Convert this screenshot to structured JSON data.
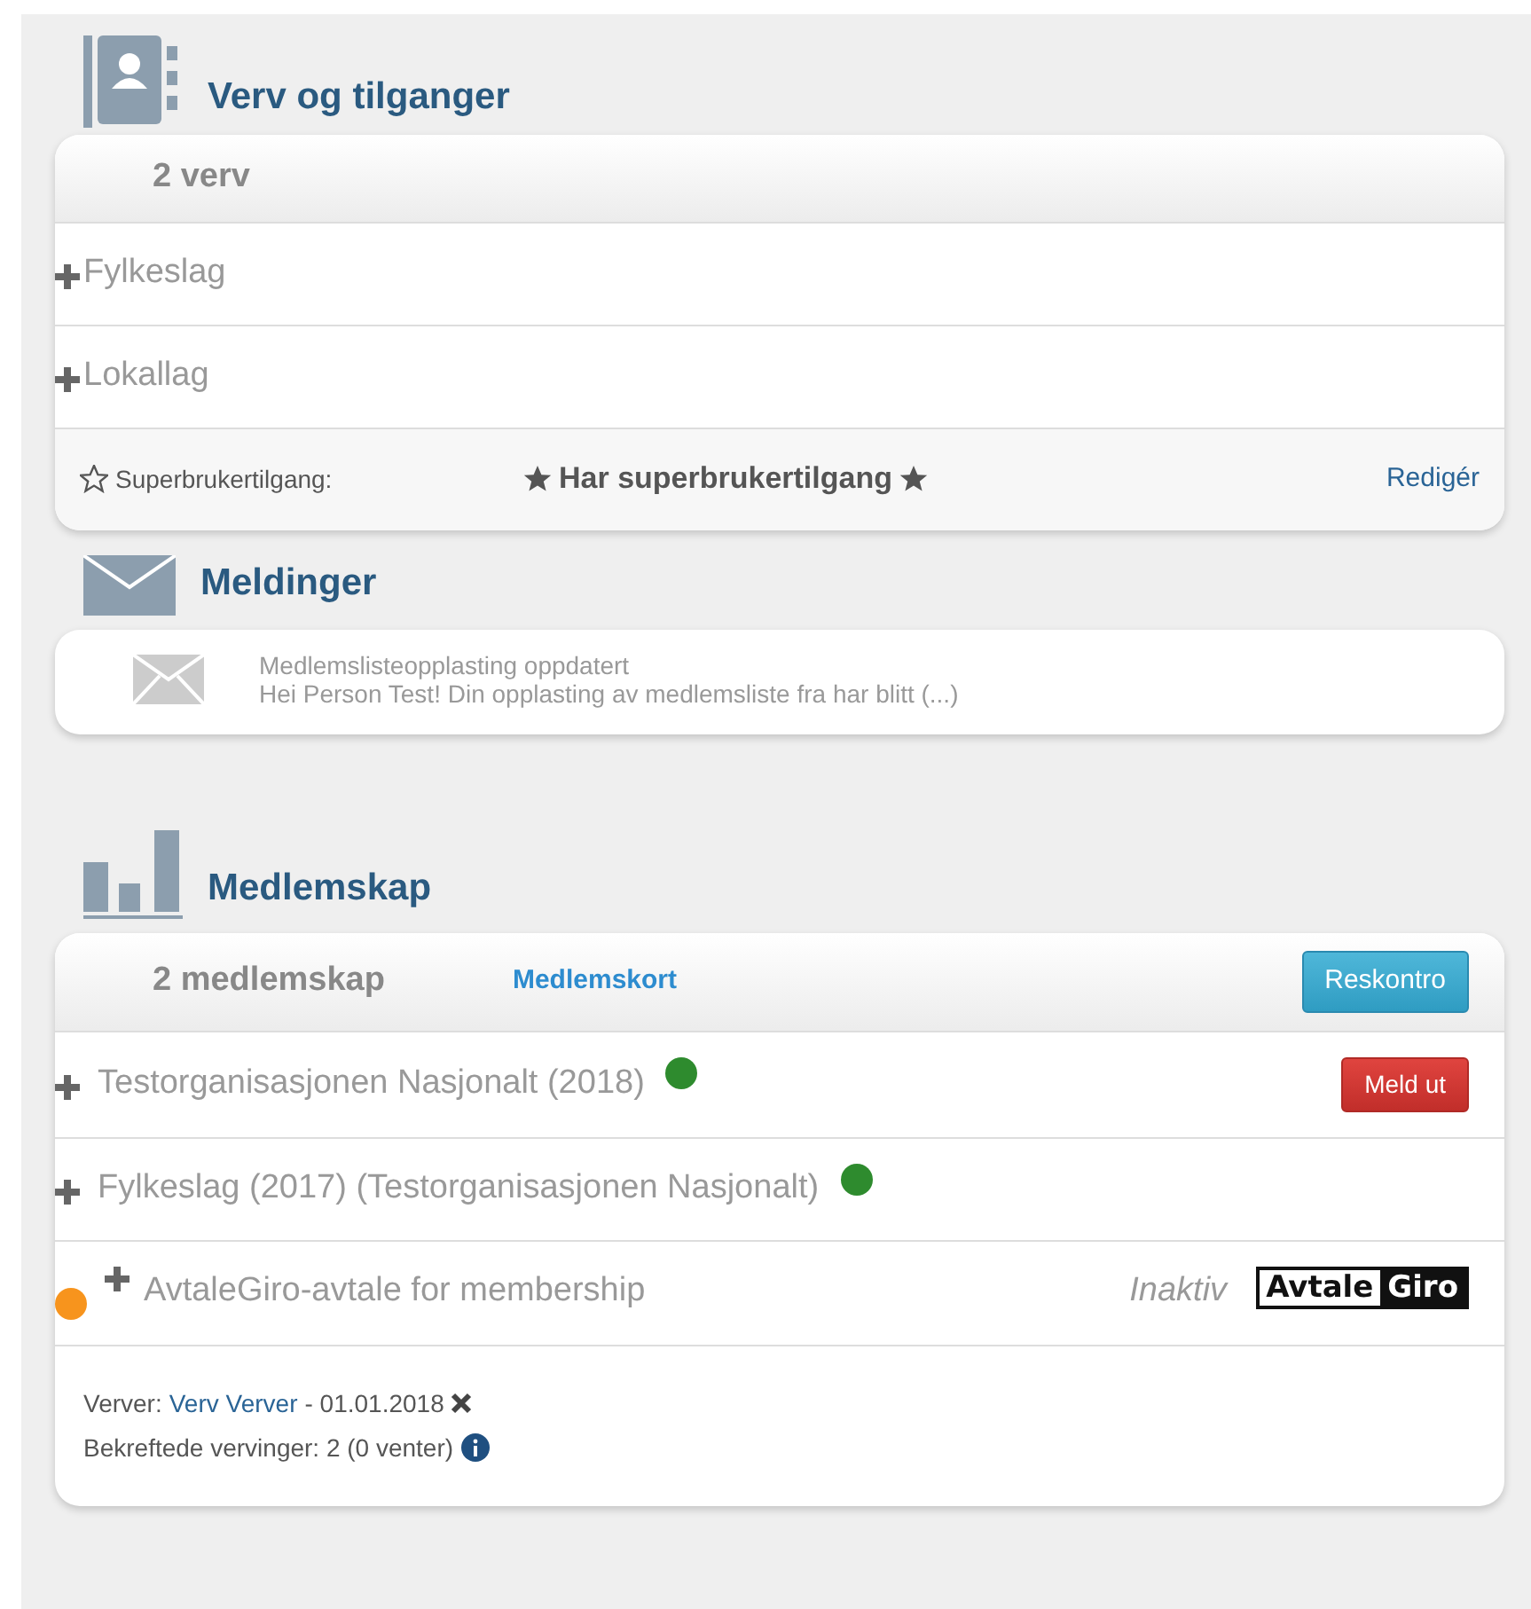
{
  "roles": {
    "title": "Verv og tilganger",
    "count": "2 verv",
    "items": [
      {
        "label": "Fylkeslag"
      },
      {
        "label": "Lokallag"
      }
    ],
    "superuser": {
      "label": "Superbrukertilgang:",
      "value": "Har superbrukertilgang",
      "action": "Redigér"
    }
  },
  "messages": {
    "title": "Meldinger",
    "items": [
      {
        "subject": "Medlemslisteopplasting oppdatert",
        "preview": "Hei Person Test! Din opplasting av medlemsliste fra har blitt (...)"
      }
    ]
  },
  "memberships": {
    "title": "Medlemskap",
    "count": "2 medlemskap",
    "card_link": "Medlemskort",
    "ledger_button": "Reskontro",
    "items": [
      {
        "kind": "membership",
        "label": "Testorganisasjonen Nasjonalt (2018)",
        "color": "#2e8b2e",
        "action": "Meld ut"
      },
      {
        "kind": "membership",
        "label": "Fylkeslag (2017) (Testorganisasjonen Nasjonalt)",
        "color": "#2e8b2e"
      },
      {
        "kind": "agreement",
        "label": "AvtaleGiro-avtale for membership",
        "color": "#f7941d",
        "status": "Inaktiv",
        "logo": [
          "Avtale",
          "Giro"
        ]
      }
    ],
    "recruiter_label": "Verver:",
    "recruiter": "Verv Verver",
    "recruiter_date": "- 01.01.2018",
    "confirmed": "Bekreftede vervinger: 2 (0 venter)"
  }
}
